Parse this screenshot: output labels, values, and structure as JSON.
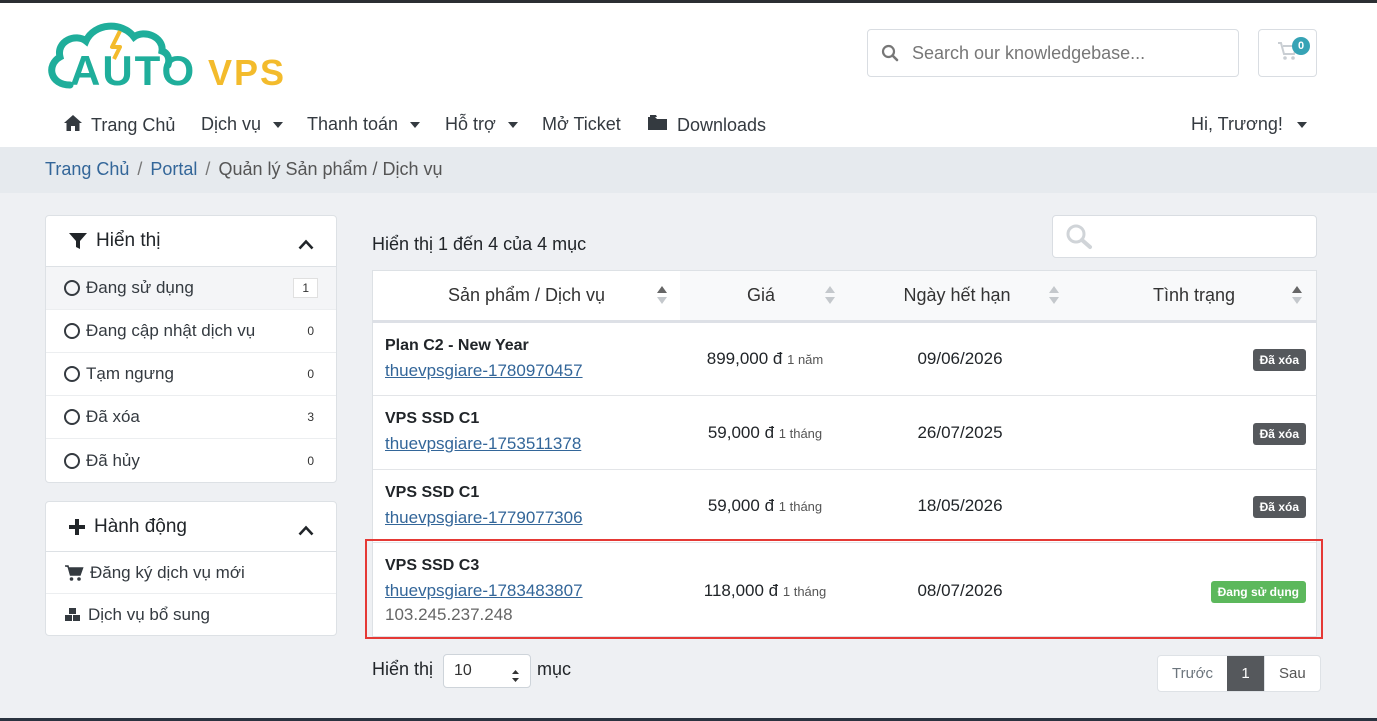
{
  "brand": {
    "logo_text_a": "AUTO",
    "logo_text_b": "VPS",
    "color_green": "#1fae9b",
    "color_yellow": "#f3bb2c"
  },
  "search": {
    "placeholder": "Search our knowledgebase..."
  },
  "cart": {
    "count": "0"
  },
  "nav": {
    "home": "Trang Chủ",
    "services": "Dịch vụ",
    "billing": "Thanh toán",
    "support": "Hỗ trợ",
    "ticket": "Mở Ticket",
    "downloads": "Downloads",
    "user": "Hi, Trương!"
  },
  "breadcrumb": {
    "home": "Trang Chủ",
    "portal": "Portal",
    "current": "Quản lý Sản phẩm / Dịch vụ"
  },
  "filter": {
    "title": "Hiển thị",
    "items": [
      {
        "label": "Đang sử dụng",
        "count": "1"
      },
      {
        "label": "Đang cập nhật dịch vụ",
        "count": "0"
      },
      {
        "label": "Tạm ngưng",
        "count": "0"
      },
      {
        "label": "Đã xóa",
        "count": "3"
      },
      {
        "label": "Đã hủy",
        "count": "0"
      }
    ]
  },
  "actions": {
    "title": "Hành động",
    "items": [
      {
        "label": "Đăng ký dịch vụ mới",
        "icon": "cart-icon"
      },
      {
        "label": "Dịch vụ bổ sung",
        "icon": "cubes-icon"
      }
    ]
  },
  "table": {
    "info": "Hiển thị 1 đến 4 của 4 mục",
    "columns": [
      "Sản phẩm / Dịch vụ",
      "Giá",
      "Ngày hết hạn",
      "Tình trạng"
    ],
    "rows": [
      {
        "name": "Plan C2 - New Year",
        "domain": "thuevpsgiare-1780970457",
        "ip": "",
        "price": "899,000 đ",
        "cycle": "1 năm",
        "due": "09/06/2026",
        "status": "Đã xóa"
      },
      {
        "name": "VPS SSD C1",
        "domain": "thuevpsgiare-1753511378",
        "ip": "",
        "price": "59,000 đ",
        "cycle": "1 tháng",
        "due": "26/07/2025",
        "status": "Đã xóa"
      },
      {
        "name": "VPS SSD C1",
        "domain": "thuevpsgiare-1779077306",
        "ip": "",
        "price": "59,000 đ",
        "cycle": "1 tháng",
        "due": "18/05/2026",
        "status": "Đã xóa"
      },
      {
        "name": "VPS SSD C3",
        "domain": "thuevpsgiare-1783483807",
        "ip": "103.245.237.248",
        "price": "118,000 đ",
        "cycle": "1 tháng",
        "due": "08/07/2026",
        "status": "Đang sử dụng"
      }
    ],
    "length_prefix": "Hiển thị",
    "length_value": "10",
    "length_suffix": "mục"
  },
  "pagination": {
    "prev": "Trước",
    "current": "1",
    "next": "Sau"
  },
  "colors": {
    "link": "#336699",
    "status_deleted": "#55585c",
    "status_active": "#5cb85c",
    "highlight": "#e53935"
  }
}
